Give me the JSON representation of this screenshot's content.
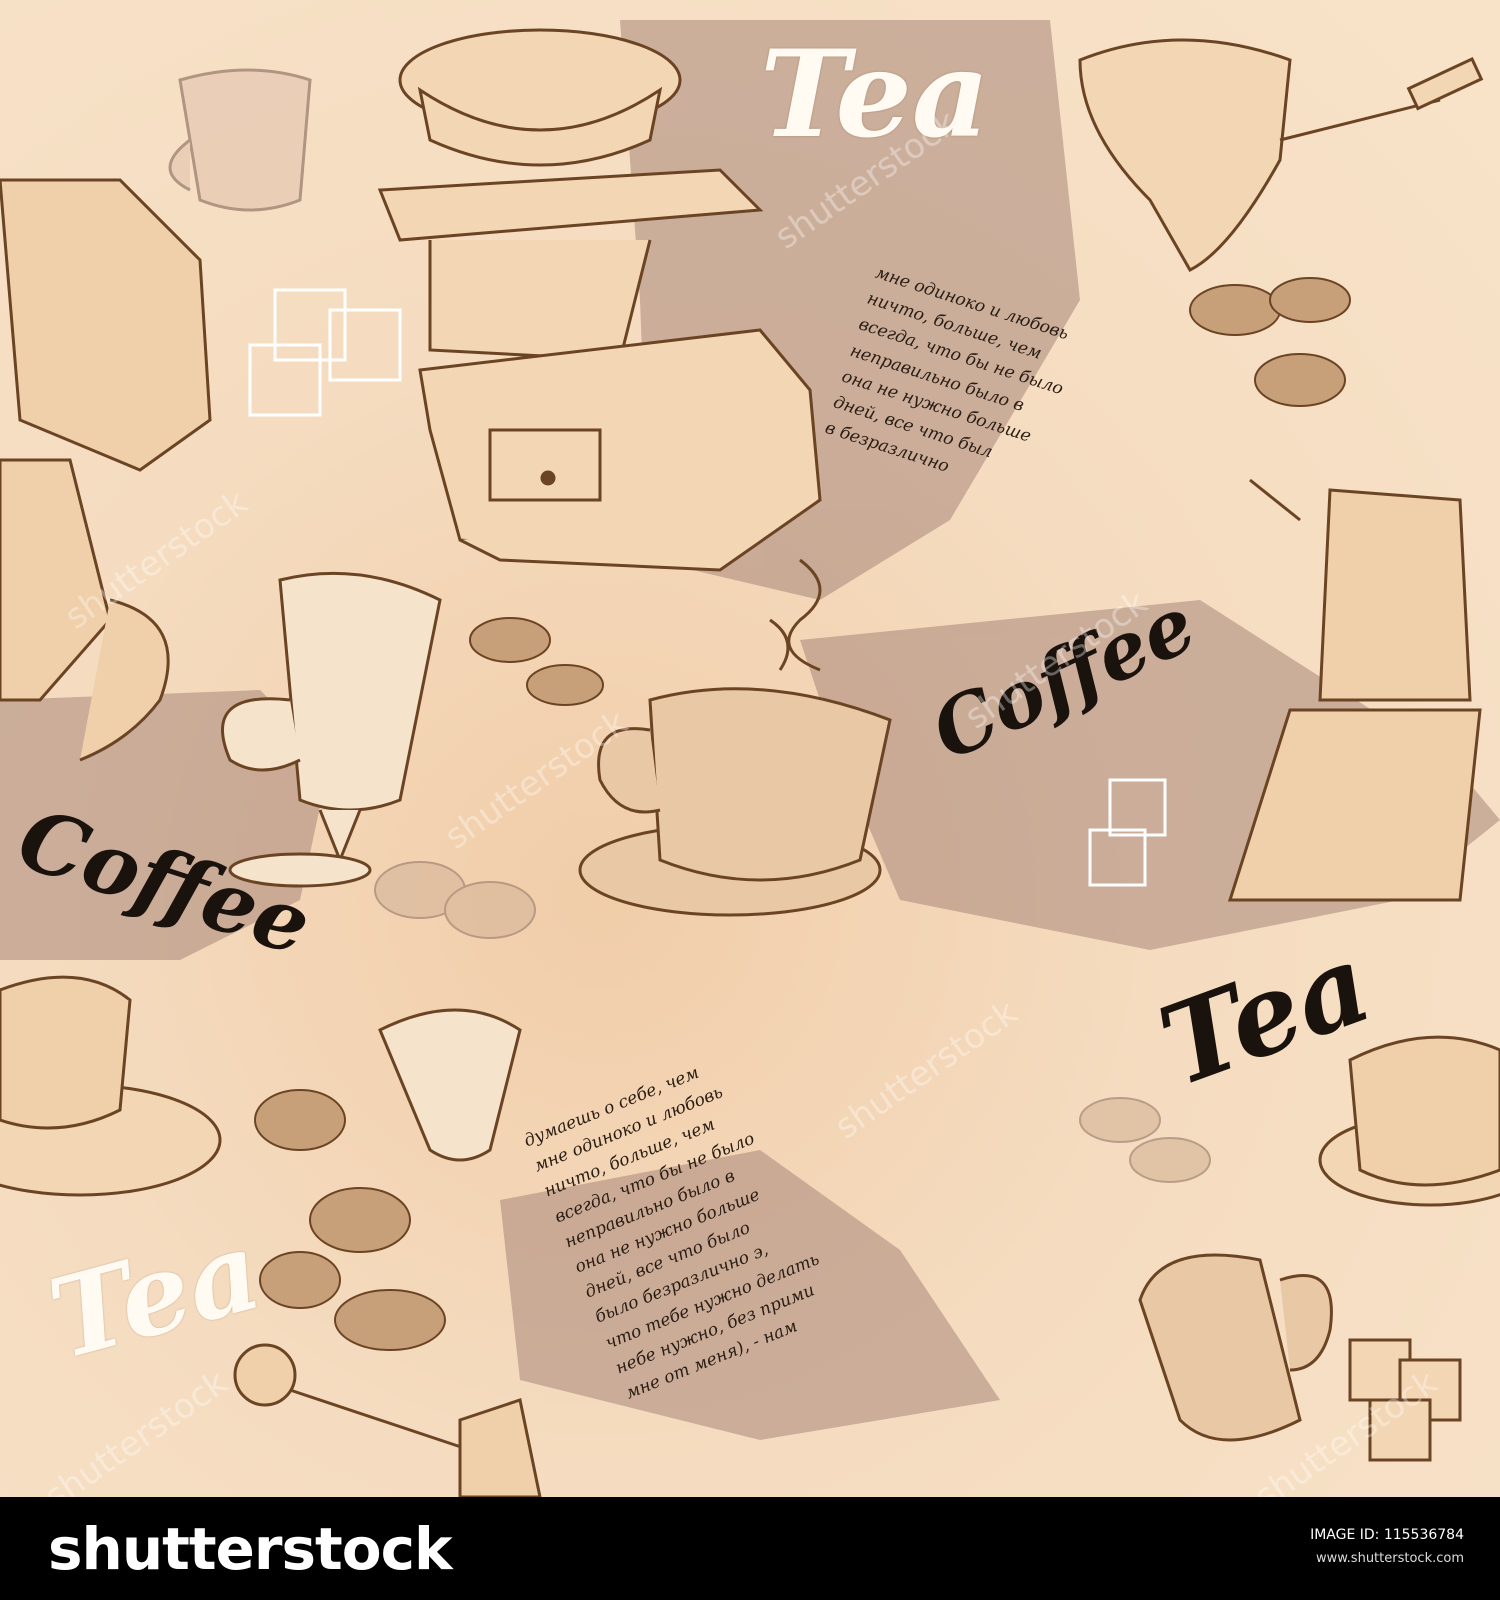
{
  "artwork": {
    "words": {
      "tea_top": "Tea",
      "tea_right": "Tea",
      "tea_bottom": "Tea",
      "coffee_center": "Coffee",
      "coffee_left": "Coffee"
    },
    "handwriting_top": "мне одиноко и любовь\nничто, больше, чем\nвсегда, что бы не было\nнеправильно было в\nона не нужно больше\nдней, все что был\nв безразлично",
    "handwriting_bottom": "думаешь о себе, чем\nмне одиноко и любовь\nничто, больше, чем\nвсегда, что бы не было\nнеправильно было в\nона не нужно больше\nдней, все что было\nбыло безразлично э,\nчто тебе нужно делать\nнебе нужно, без прими\nмне от меня), - нам",
    "watermark": "shutterstock",
    "colors": {
      "ink": "#6b4424",
      "background": "#f5dcc0",
      "splash": "#a7877a",
      "footer": "#000000"
    }
  },
  "footer": {
    "logo": "shutterstock",
    "image_id": "IMAGE ID: 115536784",
    "site": "www.shutterstock.com"
  }
}
